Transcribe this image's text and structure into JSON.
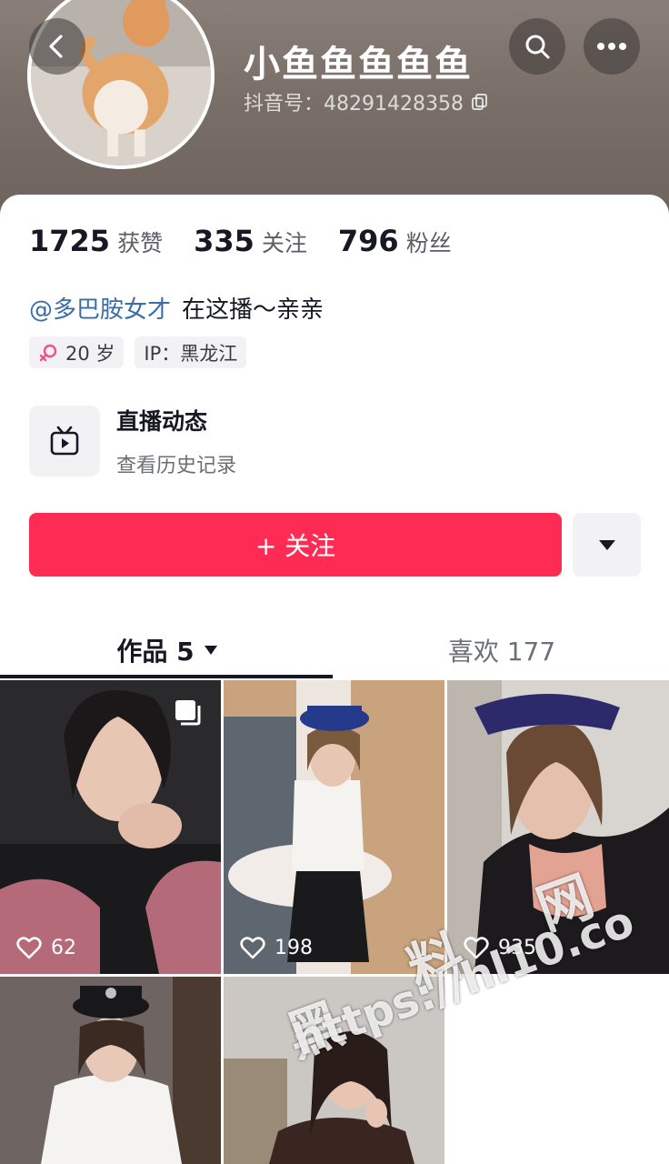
{
  "header": {
    "nickname": "小鱼鱼鱼鱼鱼",
    "douyin_id": "抖音号：48291428358"
  },
  "stats": [
    {
      "value": "1725",
      "label": "获赞"
    },
    {
      "value": "335",
      "label": "关注"
    },
    {
      "value": "796",
      "label": "粉丝"
    }
  ],
  "bio": {
    "mention": "@多巴胺女才",
    "text": "在这播～亲亲"
  },
  "tags": {
    "age": "20 岁",
    "ip": "IP：黑龙江"
  },
  "live": {
    "title": "直播动态",
    "subtitle": "查看历史记录"
  },
  "follow_button": "+ 关注",
  "tabs": {
    "works": "作品 5",
    "likes": "喜欢 177"
  },
  "videos": [
    {
      "likes": "62"
    },
    {
      "likes": "198"
    },
    {
      "likes": "935"
    }
  ],
  "watermark": {
    "chars": [
      "黑",
      "料",
      "网"
    ],
    "url": "https://hl10.co"
  },
  "colors": {
    "accent": "#fe2c55",
    "mention": "#3a6ea5",
    "header_bg": "#7a6f68"
  }
}
